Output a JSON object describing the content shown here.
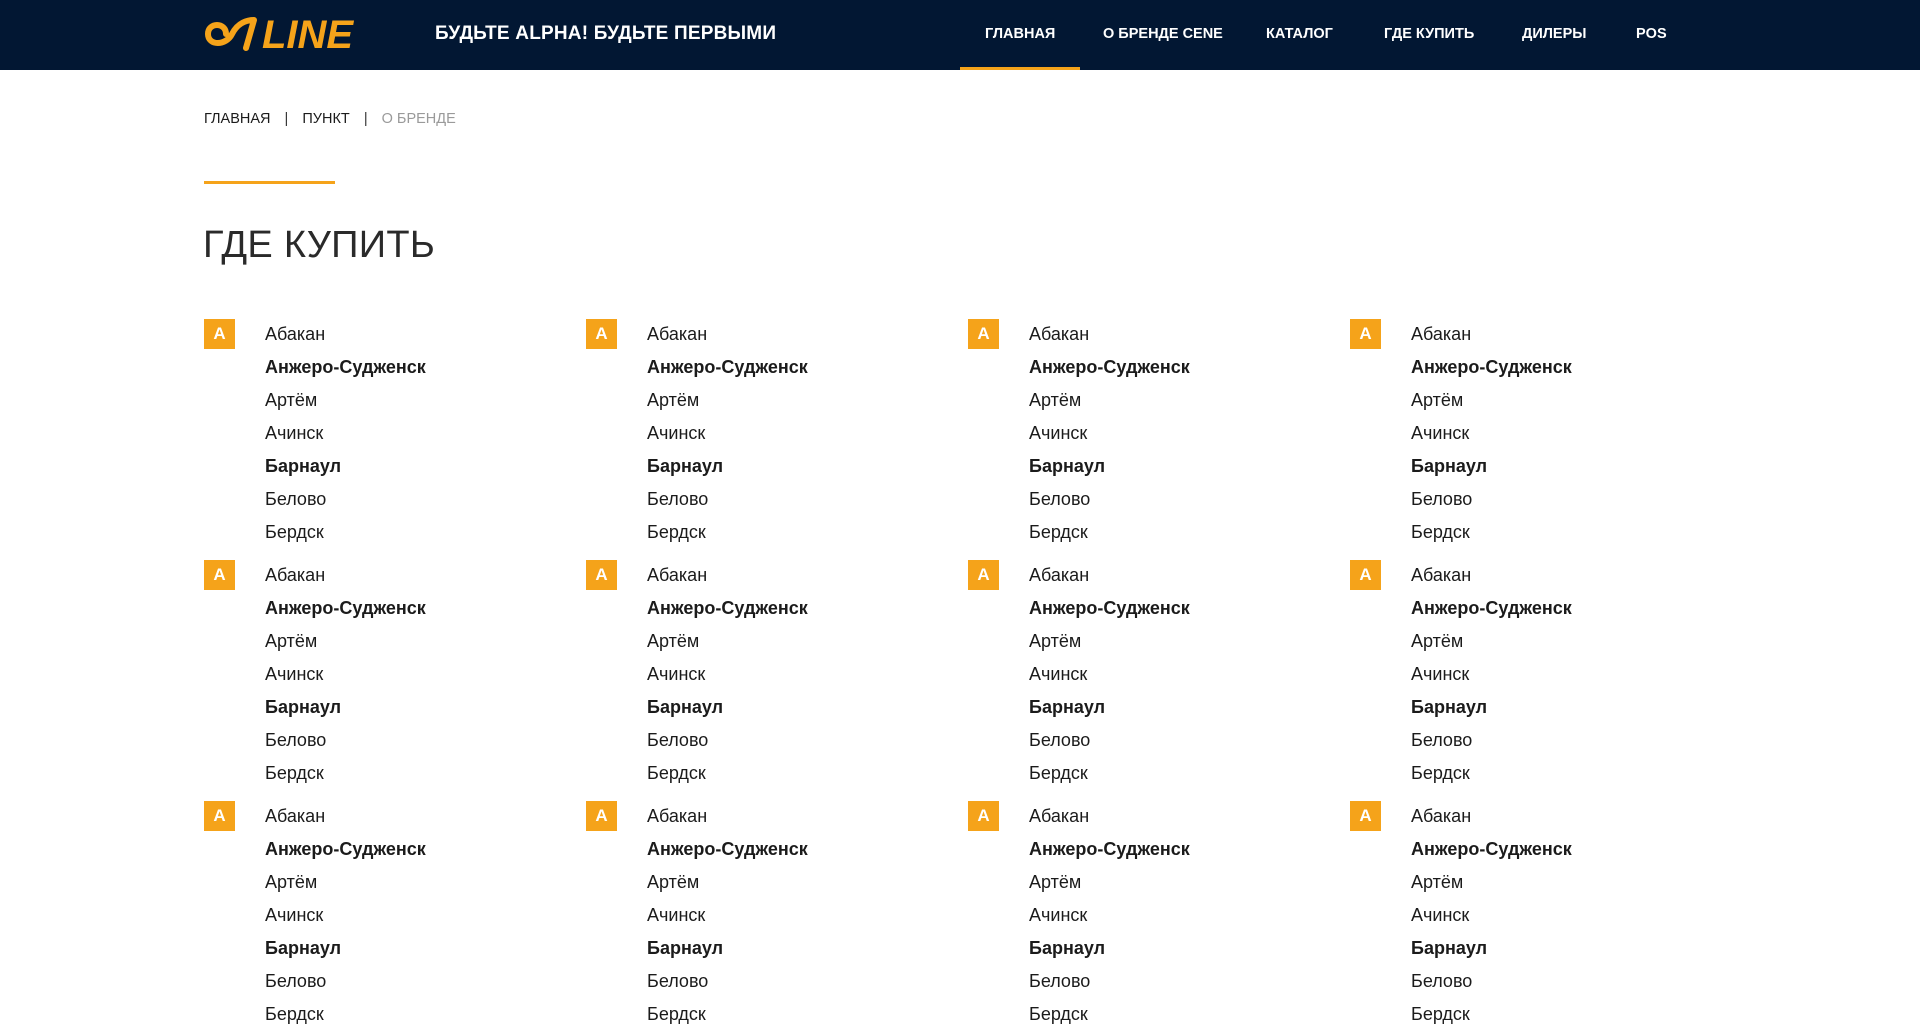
{
  "header": {
    "logo_text": "LINE",
    "slogan": "БУДЬТЕ ALPHA! БУДЬТЕ ПЕРВЫМИ",
    "nav": [
      {
        "label": "ГЛАВНАЯ",
        "active": true
      },
      {
        "label": "О БРЕНДЕ CENE",
        "active": false
      },
      {
        "label": "КАТАЛОГ",
        "active": false
      },
      {
        "label": "ГДЕ КУПИТЬ",
        "active": false
      },
      {
        "label": "ДИЛЕРЫ",
        "active": false
      },
      {
        "label": "POS",
        "active": false
      }
    ]
  },
  "breadcrumb": {
    "items": [
      "ГЛАВНАЯ",
      "ПУНКТ"
    ],
    "current": "О БРЕНДЕ",
    "separator": "|"
  },
  "page": {
    "title": "ГДЕ КУПИТЬ"
  },
  "colors": {
    "header_bg": "#021733",
    "accent": "#f5a31a",
    "text": "#1b1b1b",
    "muted": "#9a9a9a"
  },
  "city_groups": [
    {
      "letter": "А",
      "cities": [
        {
          "name": "Абакан",
          "bold": false
        },
        {
          "name": "Анжеро-Судженск",
          "bold": true
        },
        {
          "name": "Артём",
          "bold": false
        },
        {
          "name": "Ачинск",
          "bold": false
        },
        {
          "name": "Барнаул",
          "bold": true
        },
        {
          "name": "Белово",
          "bold": false
        },
        {
          "name": "Бердск",
          "bold": false
        }
      ]
    },
    {
      "letter": "А",
      "cities": [
        {
          "name": "Абакан",
          "bold": false
        },
        {
          "name": "Анжеро-Судженск",
          "bold": true
        },
        {
          "name": "Артём",
          "bold": false
        },
        {
          "name": "Ачинск",
          "bold": false
        },
        {
          "name": "Барнаул",
          "bold": true
        },
        {
          "name": "Белово",
          "bold": false
        },
        {
          "name": "Бердск",
          "bold": false
        }
      ]
    },
    {
      "letter": "А",
      "cities": [
        {
          "name": "Абакан",
          "bold": false
        },
        {
          "name": "Анжеро-Судженск",
          "bold": true
        },
        {
          "name": "Артём",
          "bold": false
        },
        {
          "name": "Ачинск",
          "bold": false
        },
        {
          "name": "Барнаул",
          "bold": true
        },
        {
          "name": "Белово",
          "bold": false
        },
        {
          "name": "Бердск",
          "bold": false
        }
      ]
    },
    {
      "letter": "А",
      "cities": [
        {
          "name": "Абакан",
          "bold": false
        },
        {
          "name": "Анжеро-Судженск",
          "bold": true
        },
        {
          "name": "Артём",
          "bold": false
        },
        {
          "name": "Ачинск",
          "bold": false
        },
        {
          "name": "Барнаул",
          "bold": true
        },
        {
          "name": "Белово",
          "bold": false
        },
        {
          "name": "Бердск",
          "bold": false
        }
      ]
    },
    {
      "letter": "А",
      "cities": [
        {
          "name": "Абакан",
          "bold": false
        },
        {
          "name": "Анжеро-Судженск",
          "bold": true
        },
        {
          "name": "Артём",
          "bold": false
        },
        {
          "name": "Ачинск",
          "bold": false
        },
        {
          "name": "Барнаул",
          "bold": true
        },
        {
          "name": "Белово",
          "bold": false
        },
        {
          "name": "Бердск",
          "bold": false
        }
      ]
    },
    {
      "letter": "А",
      "cities": [
        {
          "name": "Абакан",
          "bold": false
        },
        {
          "name": "Анжеро-Судженск",
          "bold": true
        },
        {
          "name": "Артём",
          "bold": false
        },
        {
          "name": "Ачинск",
          "bold": false
        },
        {
          "name": "Барнаул",
          "bold": true
        },
        {
          "name": "Белово",
          "bold": false
        },
        {
          "name": "Бердск",
          "bold": false
        }
      ]
    },
    {
      "letter": "А",
      "cities": [
        {
          "name": "Абакан",
          "bold": false
        },
        {
          "name": "Анжеро-Судженск",
          "bold": true
        },
        {
          "name": "Артём",
          "bold": false
        },
        {
          "name": "Ачинск",
          "bold": false
        },
        {
          "name": "Барнаул",
          "bold": true
        },
        {
          "name": "Белово",
          "bold": false
        },
        {
          "name": "Бердск",
          "bold": false
        }
      ]
    },
    {
      "letter": "А",
      "cities": [
        {
          "name": "Абакан",
          "bold": false
        },
        {
          "name": "Анжеро-Судженск",
          "bold": true
        },
        {
          "name": "Артём",
          "bold": false
        },
        {
          "name": "Ачинск",
          "bold": false
        },
        {
          "name": "Барнаул",
          "bold": true
        },
        {
          "name": "Белово",
          "bold": false
        },
        {
          "name": "Бердск",
          "bold": false
        }
      ]
    },
    {
      "letter": "А",
      "cities": [
        {
          "name": "Абакан",
          "bold": false
        },
        {
          "name": "Анжеро-Судженск",
          "bold": true
        },
        {
          "name": "Артём",
          "bold": false
        },
        {
          "name": "Ачинск",
          "bold": false
        },
        {
          "name": "Барнаул",
          "bold": true
        },
        {
          "name": "Белово",
          "bold": false
        },
        {
          "name": "Бердск",
          "bold": false
        }
      ]
    },
    {
      "letter": "А",
      "cities": [
        {
          "name": "Абакан",
          "bold": false
        },
        {
          "name": "Анжеро-Судженск",
          "bold": true
        },
        {
          "name": "Артём",
          "bold": false
        },
        {
          "name": "Ачинск",
          "bold": false
        },
        {
          "name": "Барнаул",
          "bold": true
        },
        {
          "name": "Белово",
          "bold": false
        },
        {
          "name": "Бердск",
          "bold": false
        }
      ]
    },
    {
      "letter": "А",
      "cities": [
        {
          "name": "Абакан",
          "bold": false
        },
        {
          "name": "Анжеро-Судженск",
          "bold": true
        },
        {
          "name": "Артём",
          "bold": false
        },
        {
          "name": "Ачинск",
          "bold": false
        },
        {
          "name": "Барнаул",
          "bold": true
        },
        {
          "name": "Белово",
          "bold": false
        },
        {
          "name": "Бердск",
          "bold": false
        }
      ]
    },
    {
      "letter": "А",
      "cities": [
        {
          "name": "Абакан",
          "bold": false
        },
        {
          "name": "Анжеро-Судженск",
          "bold": true
        },
        {
          "name": "Артём",
          "bold": false
        },
        {
          "name": "Ачинск",
          "bold": false
        },
        {
          "name": "Барнаул",
          "bold": true
        },
        {
          "name": "Белово",
          "bold": false
        },
        {
          "name": "Бердск",
          "bold": false
        }
      ]
    }
  ]
}
